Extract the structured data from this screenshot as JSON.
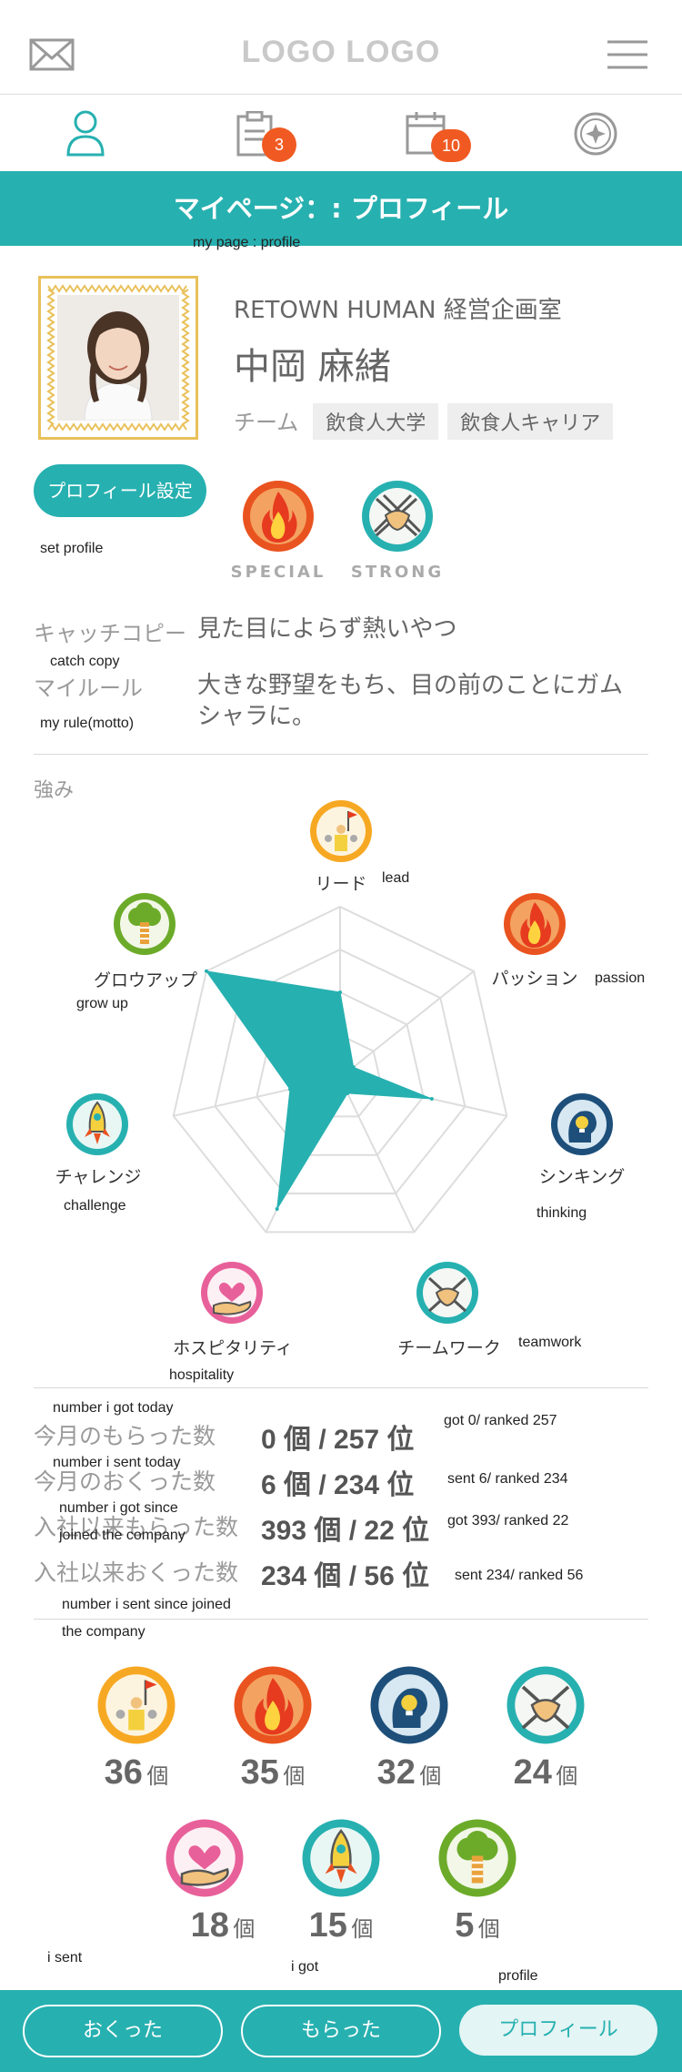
{
  "header": {
    "logo": "LOGO LOGO"
  },
  "tabs": [
    {
      "name": "profile"
    },
    {
      "name": "tasks",
      "badge": "3"
    },
    {
      "name": "calendar",
      "badge": "10"
    },
    {
      "name": "badges"
    }
  ],
  "page_title": "マイページ：: プロフィール",
  "notes": {
    "title": "my page : profile",
    "set_profile": "set profile",
    "catch_copy": "catch copy",
    "my_rule": "my rule(motto)",
    "got_today": "number i got today",
    "sent_today": "number i sent today",
    "got_since": "number i got since",
    "joined": "joined the company",
    "sent_since": "number i sent since joined",
    "the_company": "the company",
    "r1": "got 0/ ranked 257",
    "r2": "sent 6/ ranked 234",
    "r3": "got 393/ ranked 22",
    "r4": "sent 234/ ranked 56",
    "i_sent": "i sent",
    "i_got": "i got",
    "profile": "profile",
    "lead": "lead",
    "passion": "passion",
    "grow_up": "grow up",
    "challenge": "challenge",
    "thinking": "thinking",
    "hospitality": "hospitality",
    "teamwork": "teamwork"
  },
  "profile": {
    "company": "RETOWN HUMAN 経営企画室",
    "name": "中岡 麻緒",
    "team_label": "チーム",
    "teams": [
      "飲食人大学",
      "飲食人キャリア"
    ],
    "settings_button": "プロフィール設定",
    "badges": [
      "SPECIAL",
      "STRONG"
    ],
    "catch_copy_label": "キャッチコピー",
    "catch_copy": "見た目によらず熱いやつ",
    "my_rule_label": "マイルール",
    "my_rule_line1": "大きな野望をもち、目の前のことにガム",
    "my_rule_line2": "シャラに。"
  },
  "strengths": {
    "label": "強み",
    "names": {
      "lead": "リード",
      "passion": "パッション",
      "thinking": "シンキング",
      "teamwork": "チームワーク",
      "hospitality": "ホスピタリティ",
      "challenge": "チャレンジ",
      "growup": "グロウアップ"
    }
  },
  "chart_data": {
    "type": "radar",
    "categories": [
      "リード",
      "パッション",
      "シンキング",
      "チームワーク",
      "ホスピタリティ",
      "チャレンジ",
      "グロウアップ"
    ],
    "values": [
      0.5,
      0.1,
      0.55,
      0.1,
      0.85,
      0.3,
      1.0
    ],
    "ylim": [
      0,
      1
    ],
    "grid": true,
    "color": "#27b0b0"
  },
  "stats": [
    {
      "label": "今月のもらった数",
      "value": "0 個 / 257 位"
    },
    {
      "label": "今月のおくった数",
      "value": "6 個 / 234 位"
    },
    {
      "label": "入社以来もらった数",
      "value": "393 個 / 22 位"
    },
    {
      "label": "入社以来おくった数",
      "value": "234 個 / 56 位"
    }
  ],
  "counts": [
    {
      "icon": "lead",
      "n": "36",
      "unit": "個"
    },
    {
      "icon": "passion",
      "n": "35",
      "unit": "個"
    },
    {
      "icon": "thinking",
      "n": "32",
      "unit": "個"
    },
    {
      "icon": "teamwork",
      "n": "24",
      "unit": "個"
    },
    {
      "icon": "hospitality",
      "n": "18",
      "unit": "個"
    },
    {
      "icon": "challenge",
      "n": "15",
      "unit": "個"
    },
    {
      "icon": "growup",
      "n": "5",
      "unit": "個"
    }
  ],
  "footer": {
    "sent": "おくった",
    "got": "もらった",
    "profile": "プロフィール"
  },
  "colors": {
    "accent": "#27b0b0",
    "badge": "#f05a22",
    "frame": "#e9c15a"
  }
}
